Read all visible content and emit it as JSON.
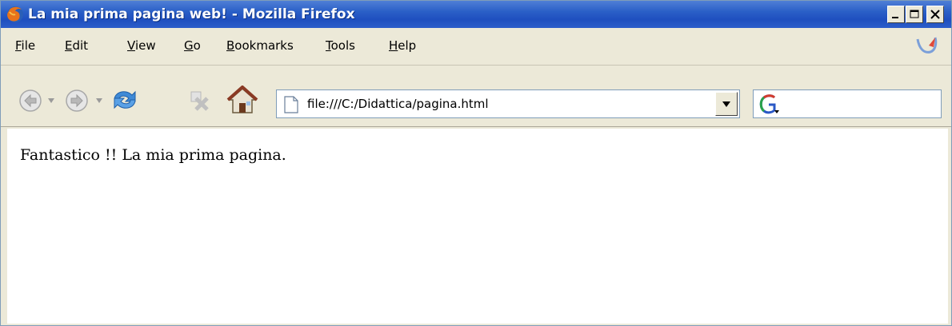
{
  "window": {
    "title": "La mia prima pagina web! - Mozilla Firefox"
  },
  "menu": {
    "items": [
      {
        "mnemonic": "F",
        "rest": "ile"
      },
      {
        "mnemonic": "E",
        "rest": "dit"
      },
      {
        "mnemonic": "V",
        "rest": "iew"
      },
      {
        "mnemonic": "G",
        "rest": "o"
      },
      {
        "mnemonic": "B",
        "rest": "ookmarks"
      },
      {
        "mnemonic": "T",
        "rest": "ools"
      },
      {
        "mnemonic": "H",
        "rest": "elp"
      }
    ]
  },
  "navigation": {
    "url": "file:///C:/Didattica/pagina.html",
    "search_engine_icon": "google-g-icon"
  },
  "page": {
    "text": "Fantastico !! La mia prima pagina."
  },
  "colors": {
    "titlebar": "#2a5fc7",
    "chrome": "#ece9d8",
    "content": "#ffffff"
  }
}
